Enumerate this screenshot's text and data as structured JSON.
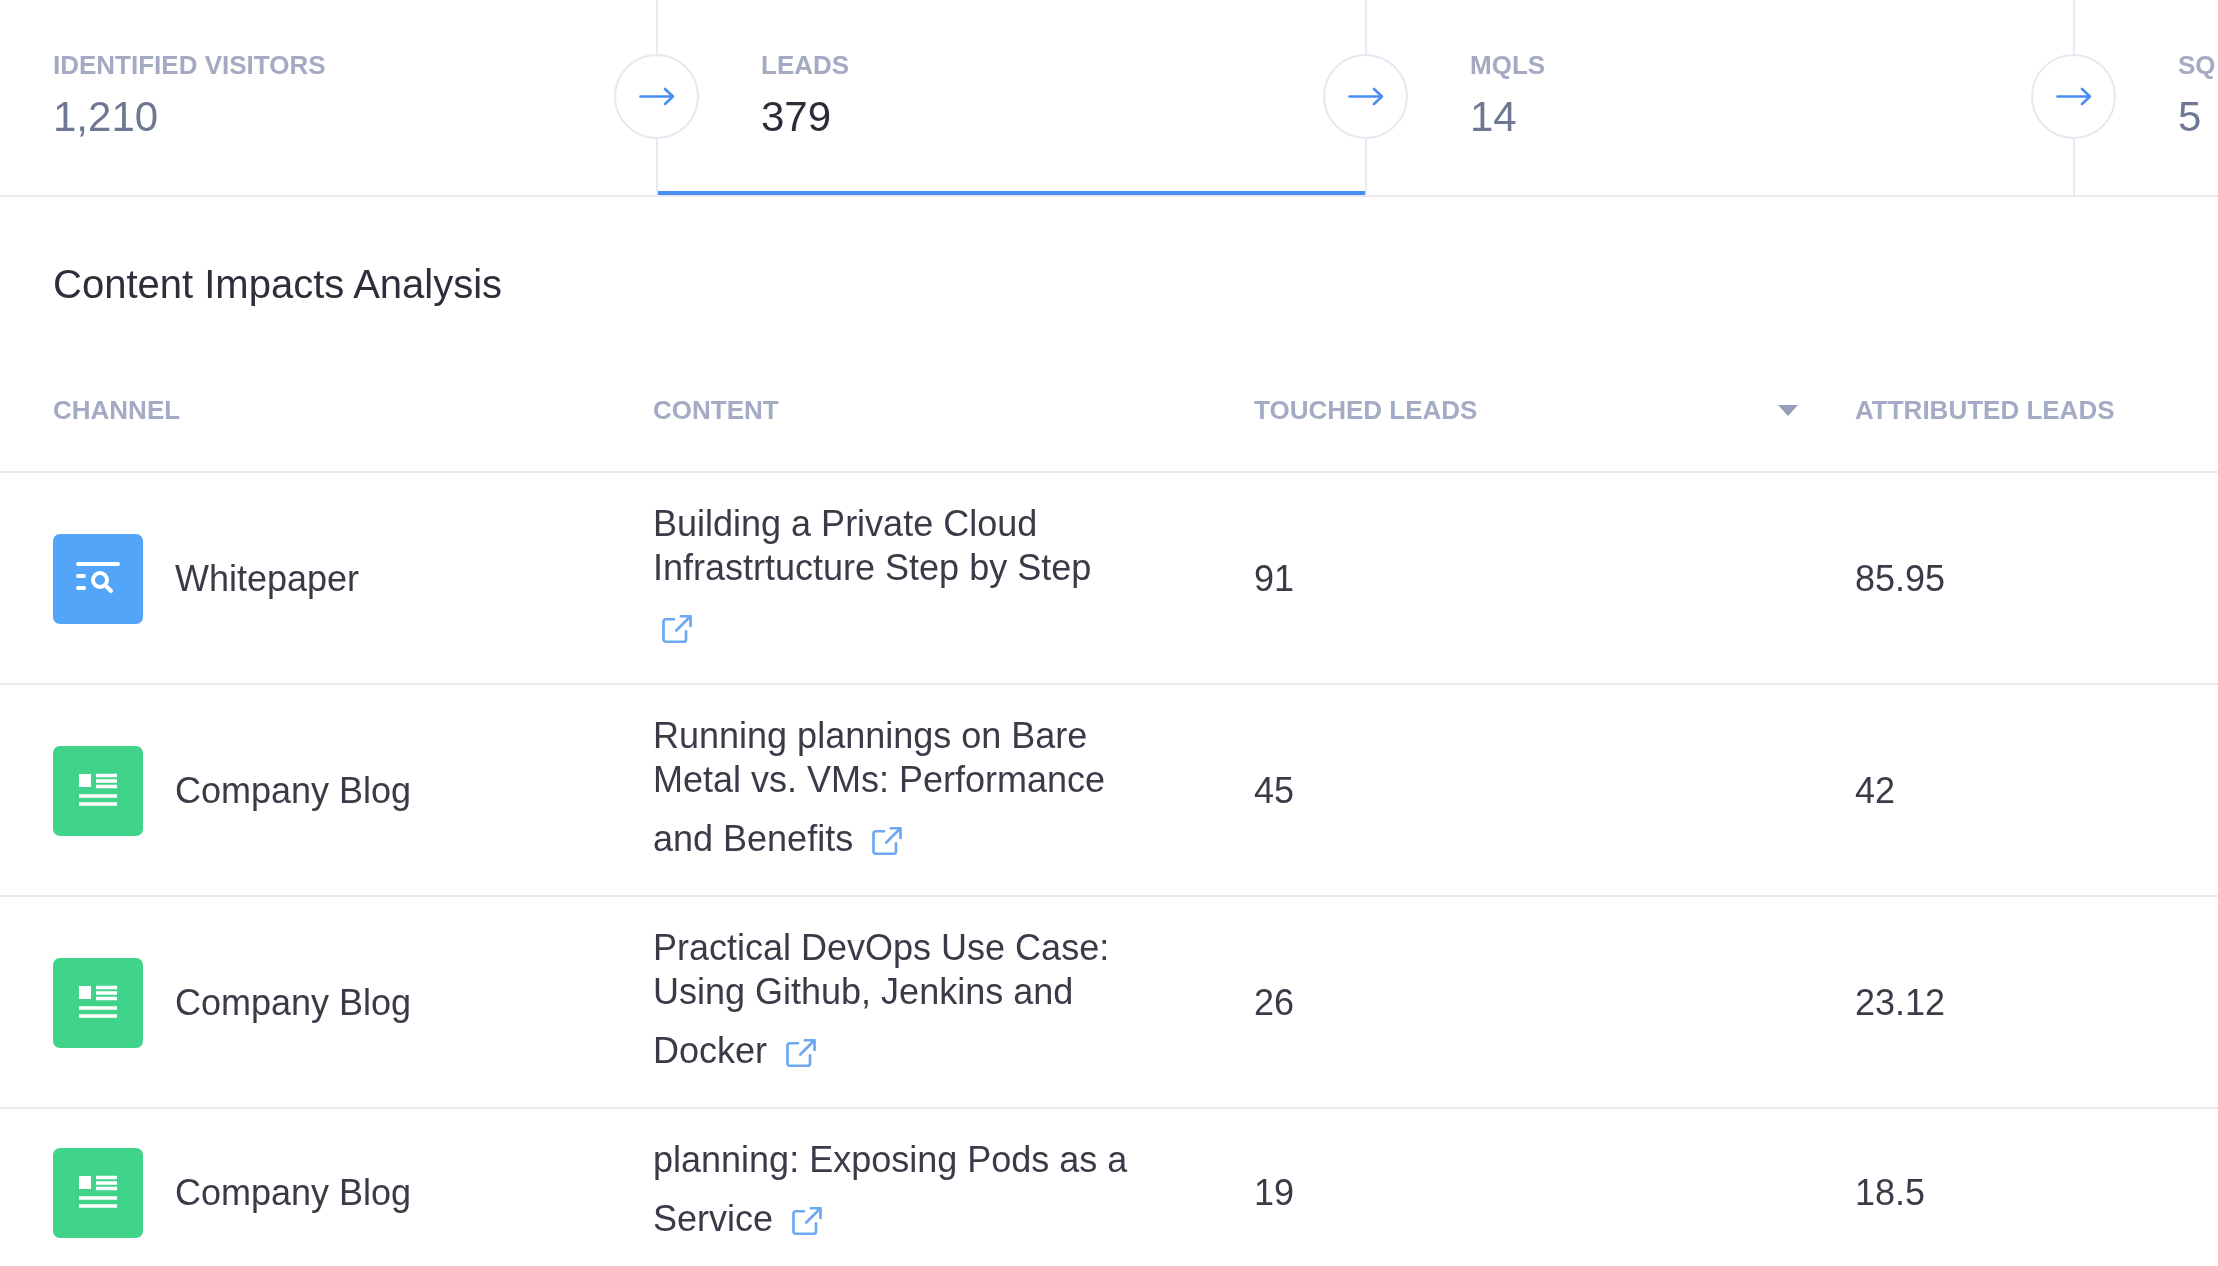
{
  "funnel": {
    "stages": [
      {
        "label": "IDENTIFIED VISITORS",
        "value": "1,210",
        "selected": false
      },
      {
        "label": "LEADS",
        "value": "379",
        "selected": true
      },
      {
        "label": "MQLS",
        "value": "14",
        "selected": false
      },
      {
        "label": "SQ",
        "value": "5",
        "selected": false
      }
    ]
  },
  "content_impacts": {
    "title": "Content Impacts Analysis",
    "table": {
      "columns": [
        {
          "label": "CHANNEL",
          "sorted": false
        },
        {
          "label": "CONTENT",
          "sorted": false
        },
        {
          "label": "TOUCHED LEADS",
          "sorted": true
        },
        {
          "label": "ATTRIBUTED LEADS",
          "sorted": false
        }
      ],
      "rows": [
        {
          "kind": "whitepaper",
          "channel": "Whitepaper",
          "content": "Building a Private Cloud Infrastrtucture Step by Step",
          "touched_leads": "91",
          "attributed_leads": "85.95"
        },
        {
          "kind": "blog",
          "channel": "Company Blog",
          "content": "Running plannings on Bare Metal vs. VMs: Performance and Benefits",
          "touched_leads": "45",
          "attributed_leads": "42"
        },
        {
          "kind": "blog",
          "channel": "Company Blog",
          "content": "Practical DevOps Use Case: Using Github, Jenkins and Docker",
          "touched_leads": "26",
          "attributed_leads": "23.12"
        },
        {
          "kind": "blog",
          "channel": "Company Blog",
          "content": "planning: Exposing Pods as a Service",
          "touched_leads": "19",
          "attributed_leads": "18.5"
        }
      ]
    }
  }
}
